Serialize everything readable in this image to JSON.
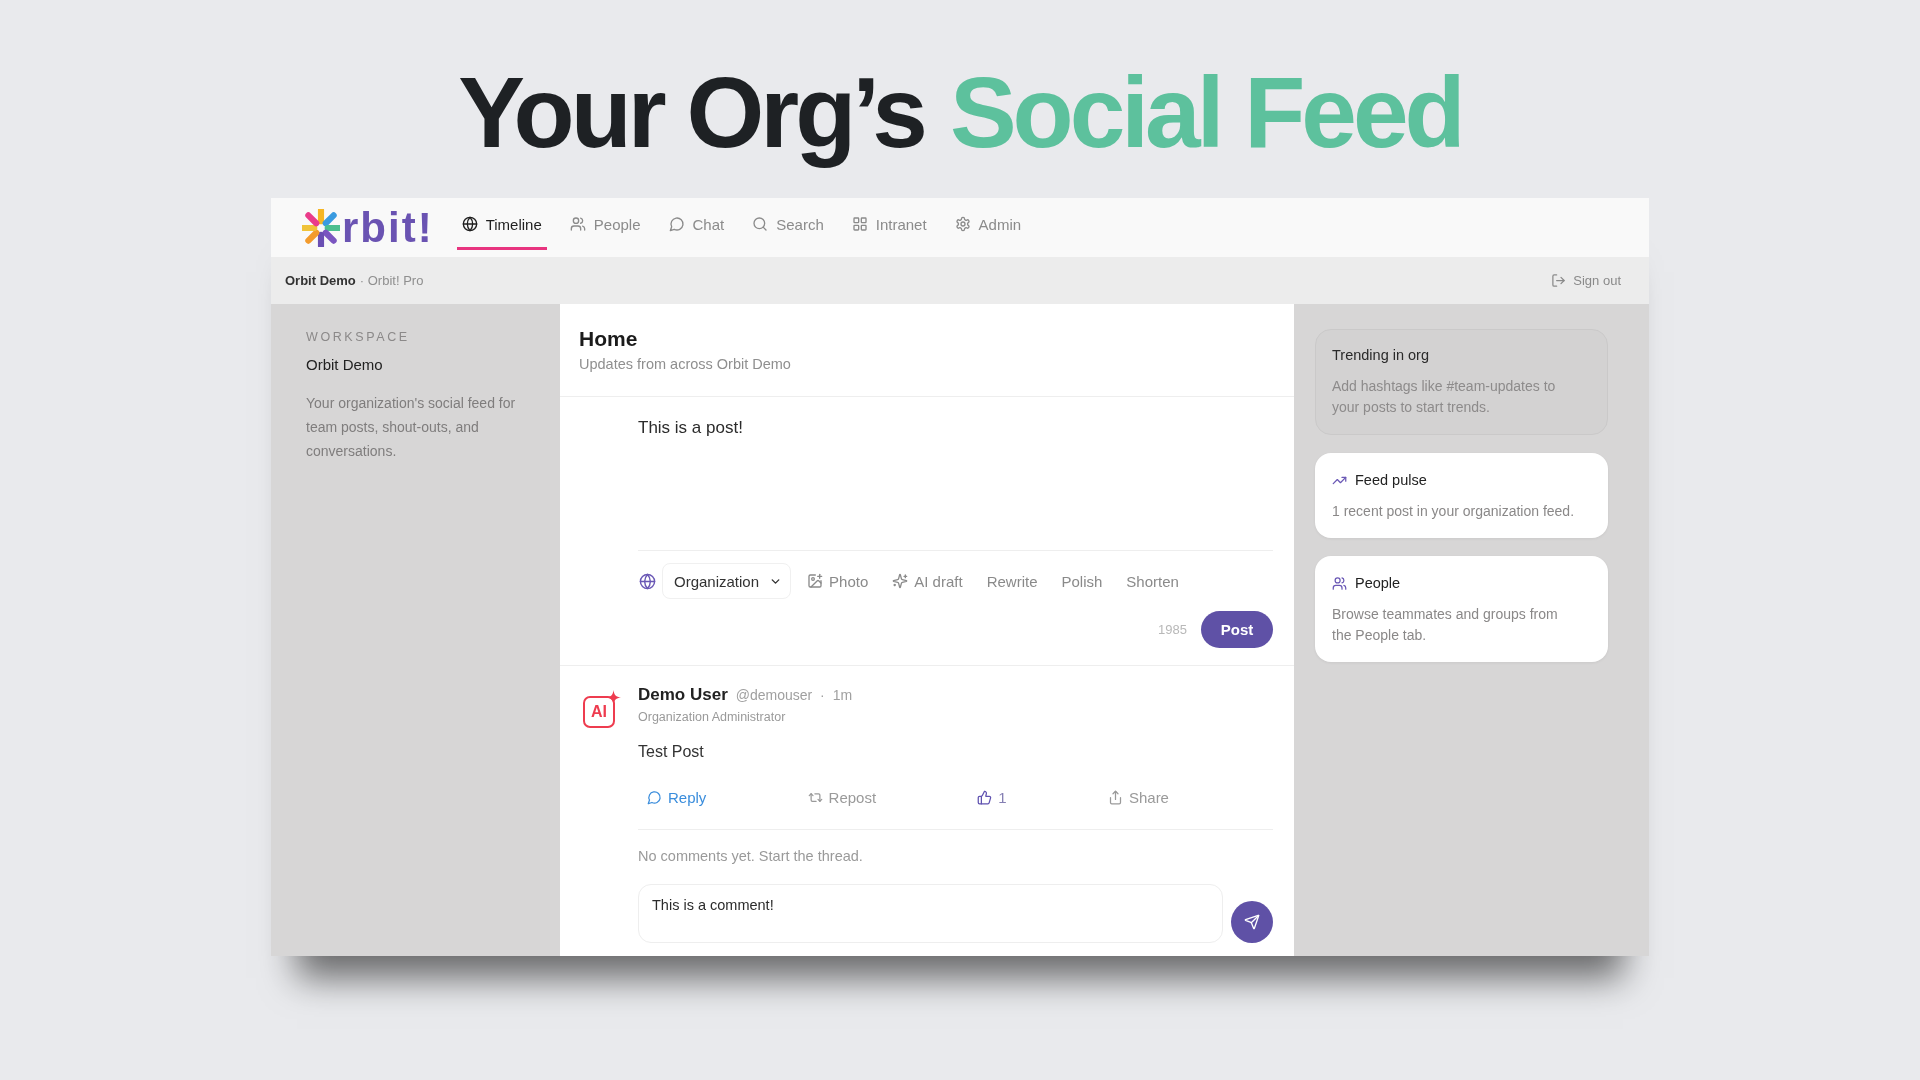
{
  "headline": {
    "parts": [
      {
        "text": "Your Org’s",
        "color": "#1e2124"
      },
      {
        "text": "Social Feed",
        "color": "#5dc19d"
      }
    ]
  },
  "app": {
    "logo": {
      "text": "rbit!"
    },
    "tabs": [
      {
        "label": "Timeline",
        "selected": true
      },
      {
        "label": "People",
        "selected": false
      },
      {
        "label": "Chat",
        "selected": false
      },
      {
        "label": "Search",
        "selected": false
      },
      {
        "label": "Intranet",
        "selected": false
      },
      {
        "label": "Admin",
        "selected": false
      }
    ],
    "breadcrumb": {
      "workspace": "Orbit Demo",
      "plan": "· Orbit! Pro"
    },
    "sign_out": "Sign out",
    "sidebar": {
      "heading": "WORKSPACE",
      "name": "Orbit Demo",
      "description": "Your organization's social feed for team posts, shout-outs, and conversations."
    },
    "feed": {
      "title": "Home",
      "subtitle": "Updates from across Orbit Demo",
      "composer": {
        "value": "This is a post!",
        "audience": "Organization",
        "tools": [
          "Photo",
          "AI draft",
          "Rewrite",
          "Polish",
          "Shorten"
        ],
        "counter": "1985",
        "submit": "Post"
      },
      "post": {
        "avatar": "AI",
        "author": "Demo User",
        "meta": "@demouser · 1m",
        "role": "Organization Administrator",
        "body": "Test Post",
        "actions": [
          {
            "kind": "reply",
            "label": "Reply",
            "active": true
          },
          {
            "kind": "repost",
            "label": "Repost",
            "active": false
          },
          {
            "kind": "like",
            "label": "1",
            "active": true
          },
          {
            "kind": "share",
            "label": "Share",
            "active": false
          }
        ],
        "comments_empty": "No comments yet. Start the thread.",
        "comment_value": "This is a comment!"
      }
    },
    "panel": {
      "cards": [
        {
          "kind": "hint",
          "title": "Trending in org",
          "body": "Add hashtags like #team-updates to your posts to start trends."
        },
        {
          "kind": "pulse",
          "title": "Feed pulse",
          "body": "1 recent post in your organization feed."
        },
        {
          "kind": "people",
          "title": "People",
          "body": "Browse teammates and groups from the People tab."
        }
      ]
    }
  }
}
